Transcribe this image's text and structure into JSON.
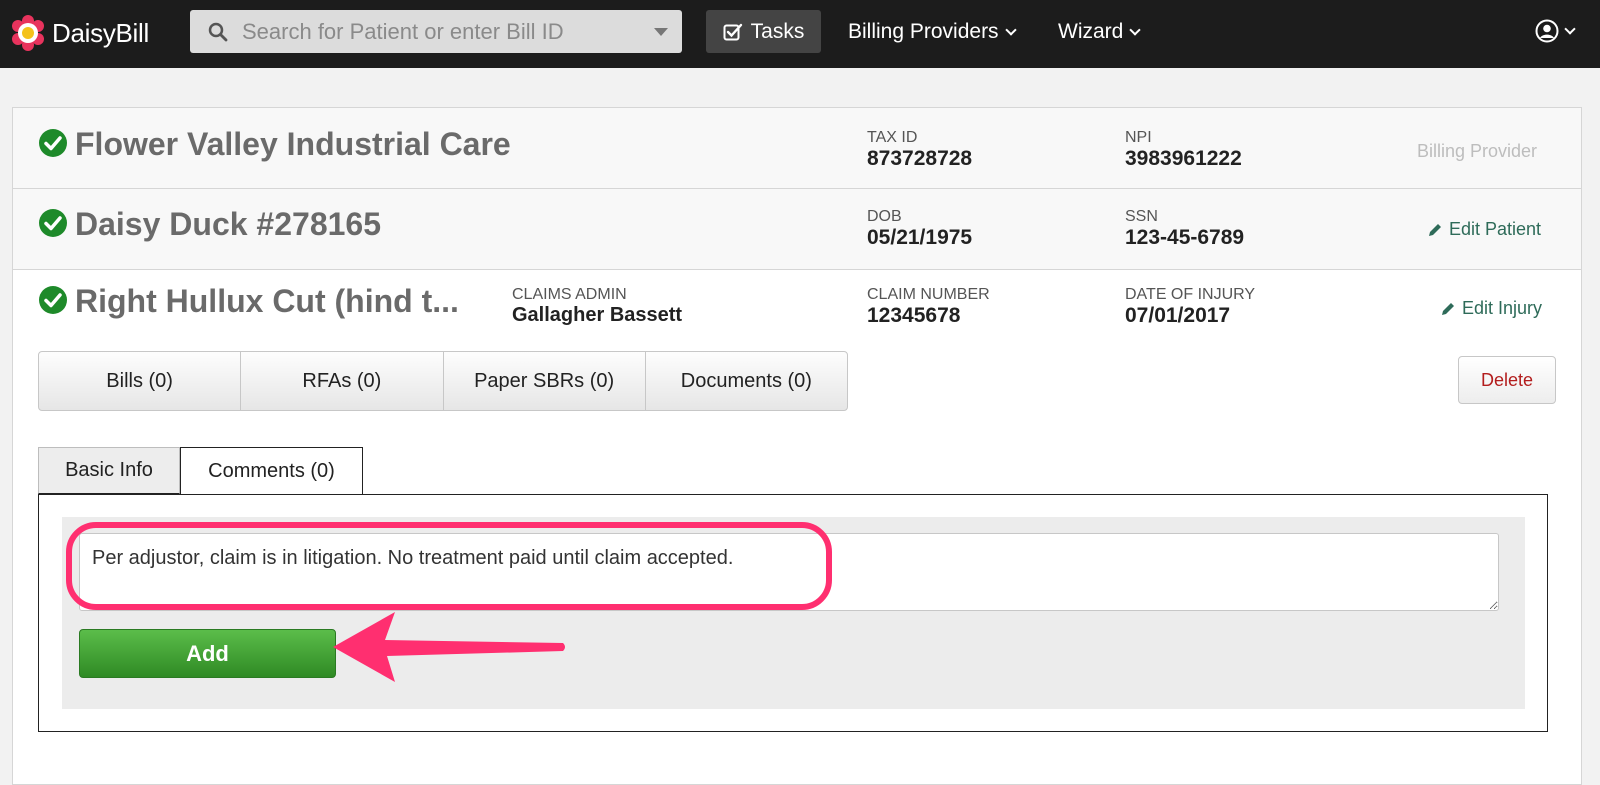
{
  "app": {
    "brand_name": "DaisyBill",
    "search_placeholder": "Search for Patient or enter Bill ID",
    "nav": {
      "tasks_label": "Tasks",
      "billing_providers_label": "Billing Providers",
      "wizard_label": "Wizard"
    }
  },
  "provider": {
    "name": "Flower Valley Industrial Care",
    "tax_id_label": "TAX ID",
    "tax_id": "873728728",
    "npi_label": "NPI",
    "npi": "3983961222",
    "role_label": "Billing Provider"
  },
  "patient": {
    "name": "Daisy Duck #278165",
    "dob_label": "DOB",
    "dob": "05/21/1975",
    "ssn_label": "SSN",
    "ssn": "123-45-6789",
    "edit_label": "Edit Patient"
  },
  "injury": {
    "name": "Right Hullux Cut (hind t...",
    "claims_admin_label": "CLAIMS ADMIN",
    "claims_admin": "Gallagher Bassett",
    "claim_number_label": "CLAIM NUMBER",
    "claim_number": "12345678",
    "date_of_injury_label": "DATE OF INJURY",
    "date_of_injury": "07/01/2017",
    "edit_label": "Edit Injury"
  },
  "segments": [
    "Bills (0)",
    "RFAs (0)",
    "Paper SBRs (0)",
    "Documents (0)"
  ],
  "delete_label": "Delete",
  "tabs": {
    "basic_info": "Basic Info",
    "comments": "Comments (0)"
  },
  "comment_box": {
    "value": "Per adjustor, claim is in litigation. No treatment paid until claim accepted.",
    "add_label": "Add"
  },
  "colors": {
    "nav_bg": "#1c1c1c",
    "check_green": "#1e8a2a",
    "highlight": "#ff2f70",
    "add_green": "#3e9e32",
    "delete_red": "#b31d1d"
  }
}
